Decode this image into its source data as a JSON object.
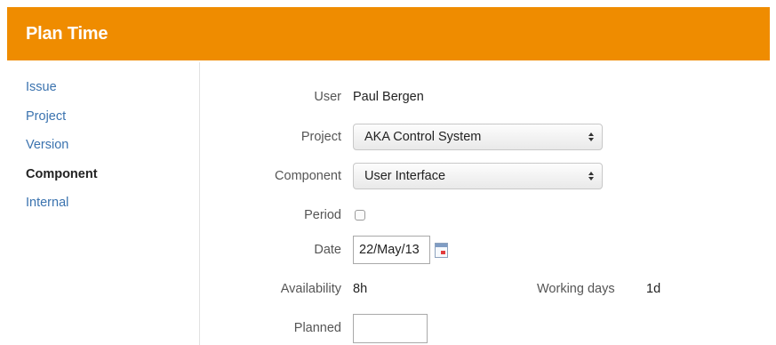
{
  "header": {
    "title": "Plan Time",
    "color": "#ef8c00"
  },
  "nav": {
    "items": [
      {
        "label": "Issue",
        "active": false
      },
      {
        "label": "Project",
        "active": false
      },
      {
        "label": "Version",
        "active": false
      },
      {
        "label": "Component",
        "active": true
      },
      {
        "label": "Internal",
        "active": false
      }
    ]
  },
  "form": {
    "user": {
      "label": "User",
      "value": "Paul Bergen"
    },
    "project": {
      "label": "Project",
      "value": "AKA Control System"
    },
    "component": {
      "label": "Component",
      "value": "User Interface"
    },
    "period": {
      "label": "Period",
      "checked": false
    },
    "date": {
      "label": "Date",
      "value": "22/May/13",
      "icon": "calendar-icon"
    },
    "availability": {
      "label": "Availability",
      "value": "8h"
    },
    "working_days": {
      "label": "Working days",
      "value": "1d"
    },
    "planned": {
      "label": "Planned",
      "value": ""
    }
  }
}
